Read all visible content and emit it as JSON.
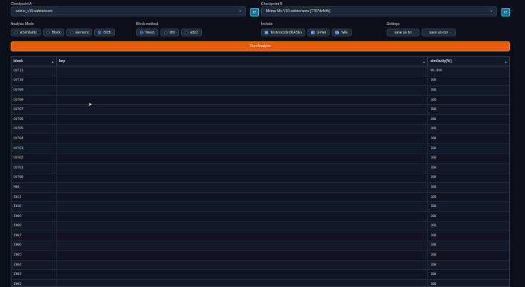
{
  "checkpoint_a": {
    "label": "Checkpoint A",
    "value": "anime_v10.safetensors",
    "refresh_icon": "refresh-icon"
  },
  "checkpoint_b": {
    "label": "Checkpoint B",
    "value": "Meina Mix V10.safetensors [7767dcfeffc]",
    "refresh_icon": "refresh-icon"
  },
  "analysis_mode": {
    "label": "Analysis Mode",
    "options": [
      "ASimilarity",
      "Block",
      "Element",
      "Both"
    ],
    "selected": "Both"
  },
  "block_method": {
    "label": "Block method",
    "options": [
      "Mean",
      "Min",
      "attn2"
    ],
    "selected": "Mean"
  },
  "include": {
    "label": "Include",
    "options": [
      "Textencoder(BASE)",
      "U-Net",
      "VAE"
    ]
  },
  "settings": {
    "label": "Settings",
    "options": [
      "save as txt",
      "save as csv"
    ]
  },
  "run_button": "Run Analysis",
  "table": {
    "headers": [
      "block",
      "key",
      "similarity[%]"
    ],
    "rows": [
      {
        "block": "OUT11",
        "key": "",
        "sim": "99.999"
      },
      {
        "block": "OUT10",
        "key": "",
        "sim": "100"
      },
      {
        "block": "OUT09",
        "key": "",
        "sim": "100"
      },
      {
        "block": "OUT08",
        "key": "",
        "sim": "100"
      },
      {
        "block": "OUT07",
        "key": "",
        "sim": "100"
      },
      {
        "block": "OUT06",
        "key": "",
        "sim": "100"
      },
      {
        "block": "OUT05",
        "key": "",
        "sim": "100"
      },
      {
        "block": "OUT04",
        "key": "",
        "sim": "100"
      },
      {
        "block": "OUT03",
        "key": "",
        "sim": "100"
      },
      {
        "block": "OUT02",
        "key": "",
        "sim": "100"
      },
      {
        "block": "OUT01",
        "key": "",
        "sim": "100"
      },
      {
        "block": "OUT00",
        "key": "",
        "sim": "100"
      },
      {
        "block": "M00",
        "key": "",
        "sim": "100"
      },
      {
        "block": "IN11",
        "key": "",
        "sim": "100"
      },
      {
        "block": "IN10",
        "key": "",
        "sim": "100"
      },
      {
        "block": "IN09",
        "key": "",
        "sim": "100"
      },
      {
        "block": "IN08",
        "key": "",
        "sim": "100"
      },
      {
        "block": "IN07",
        "key": "",
        "sim": "100"
      },
      {
        "block": "IN06",
        "key": "",
        "sim": "100"
      },
      {
        "block": "IN05",
        "key": "",
        "sim": "100"
      },
      {
        "block": "IN04",
        "key": "",
        "sim": "100"
      },
      {
        "block": "IN03",
        "key": "",
        "sim": "100"
      },
      {
        "block": "IN02",
        "key": "",
        "sim": "100"
      }
    ]
  }
}
